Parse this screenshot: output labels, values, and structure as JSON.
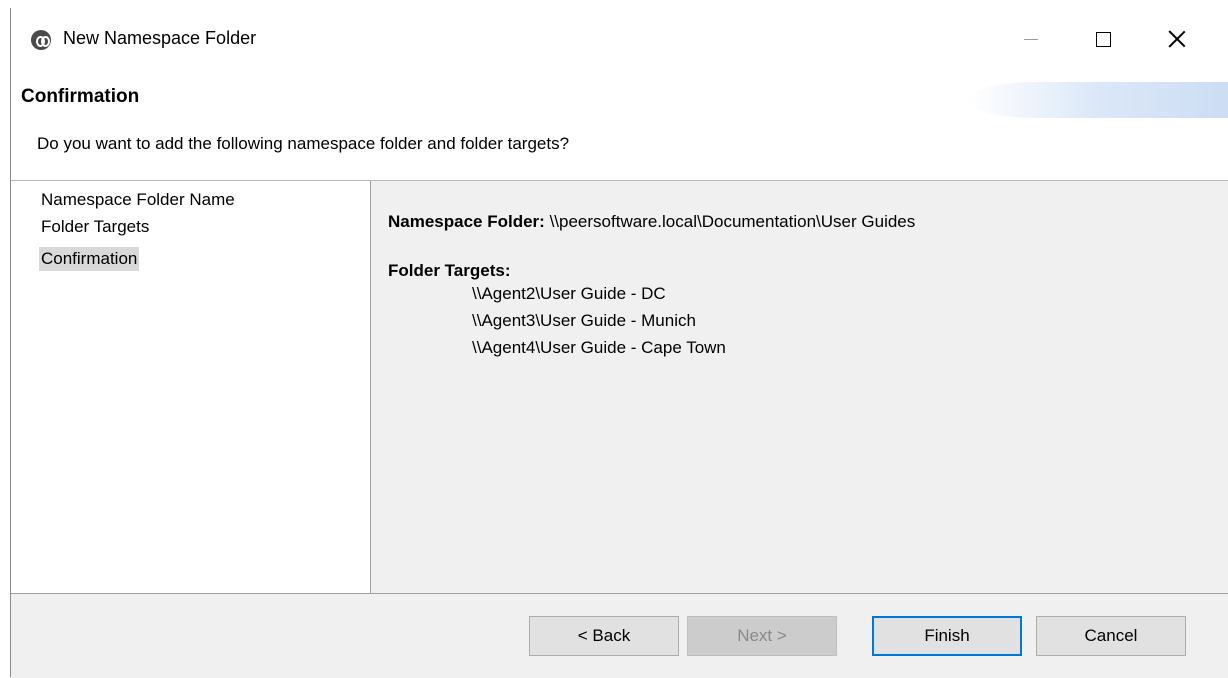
{
  "window": {
    "title": "New Namespace Folder"
  },
  "header": {
    "title": "Confirmation",
    "description": "Do you want to add the following namespace folder and folder targets?"
  },
  "nav": {
    "items": [
      {
        "label": "Namespace Folder Name",
        "selected": false
      },
      {
        "label": "Folder Targets",
        "selected": false
      },
      {
        "label": "Confirmation",
        "selected": true
      }
    ]
  },
  "content": {
    "namespace_folder_label": "Namespace Folder:",
    "namespace_folder_value": "\\\\peersoftware.local\\Documentation\\User Guides",
    "folder_targets_label": "Folder Targets:",
    "folder_targets": [
      "\\\\Agent2\\User Guide - DC",
      "\\\\Agent3\\User Guide - Munich",
      "\\\\Agent4\\User Guide - Cape Town"
    ]
  },
  "footer": {
    "back_label": "< Back",
    "next_label": "Next >",
    "finish_label": "Finish",
    "cancel_label": "Cancel"
  },
  "colors": {
    "focus_border": "#0078d7",
    "selected_nav_bg": "#d9d9d9",
    "panel_bg": "#f0f0f0"
  },
  "icons": {
    "app": "peer-software-app-icon",
    "minimize": "minimize-icon",
    "maximize": "maximize-icon",
    "close": "close-icon"
  }
}
